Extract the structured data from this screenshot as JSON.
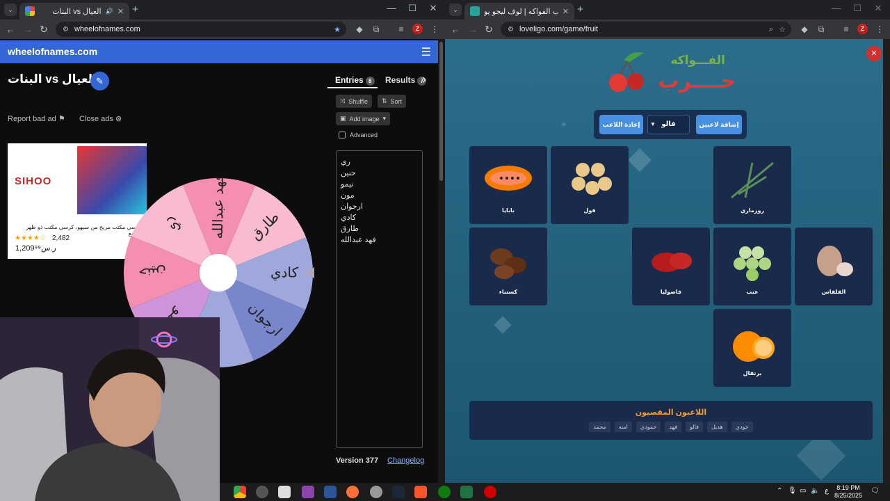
{
  "left_browser": {
    "tab_title": "البنات vs العيال",
    "url": "wheelofnames.com"
  },
  "right_browser": {
    "tab_title": "لعبة حرب الفواكه | لوف ليجو يو...",
    "url": "loveligo.com/game/fruit"
  },
  "wheel_app": {
    "logo": "wheelofnames.com",
    "wheel_title": "البنات vs العيال",
    "report_ad": "Report bad ad",
    "close_ads": "Close ads",
    "tabs": {
      "entries": "Entries",
      "entries_count": "8",
      "results": "Results",
      "results_count": "7"
    },
    "shuffle": "Shuffle",
    "sort": "Sort",
    "add_image": "Add image",
    "advanced": "Advanced",
    "entries": [
      "ري",
      "حنين",
      "نيمو",
      "مون",
      "ارجوان",
      "كادي",
      "طارق",
      "فهد عبدالله"
    ],
    "version": "Version 377",
    "changelog": "Changelog",
    "wheel_labels": [
      "فهد عبدالله",
      "طارق",
      "كادي",
      "ارجوان",
      "مون",
      "نيمو",
      "حنين",
      "ري"
    ],
    "wheel_colors": [
      "#f48fb1",
      "#f8bbd0",
      "#9fa8da",
      "#7986cb",
      "#9fa8da",
      "#ce93d8",
      "#f48fb1",
      "#f8bbd0"
    ]
  },
  "ad": {
    "brand": "SIHOO",
    "description": "كرسي مكتب مريح من سيهو، كرسي مكتب ذو ظهر مرتفع",
    "rating_stars": "★★★★☆",
    "reviews": "2,482",
    "price": "1,209⁹⁹ر.س"
  },
  "game": {
    "title": "حرب الفواكه",
    "add_players": "إضافة لاعبين",
    "selected_player": "فالو",
    "reset_player": "إعادة اللاعب",
    "cards": [
      {
        "label": "بابايا",
        "icon": "papaya-icon"
      },
      {
        "label": "فول",
        "icon": "beans-icon"
      },
      {
        "label": "روزماري",
        "icon": "rosemary-icon"
      },
      {
        "label": "كستناء",
        "icon": "chestnut-icon"
      },
      {
        "label": "فاصوليا",
        "icon": "kidney-bean-icon"
      },
      {
        "label": "عنب",
        "icon": "grapes-icon"
      },
      {
        "label": "القلقاس",
        "icon": "taro-icon"
      },
      {
        "label": "برتقال",
        "icon": "orange-icon"
      }
    ],
    "eliminated_title": "اللاعبون المقصيون",
    "eliminated": [
      "جودي",
      "هديل",
      "فالو",
      "فهد",
      "حمودي",
      "امنه",
      "محمد"
    ]
  },
  "taskbar": {
    "time": "8:19 PM",
    "date": "8/25/2025",
    "lang": "ع"
  }
}
